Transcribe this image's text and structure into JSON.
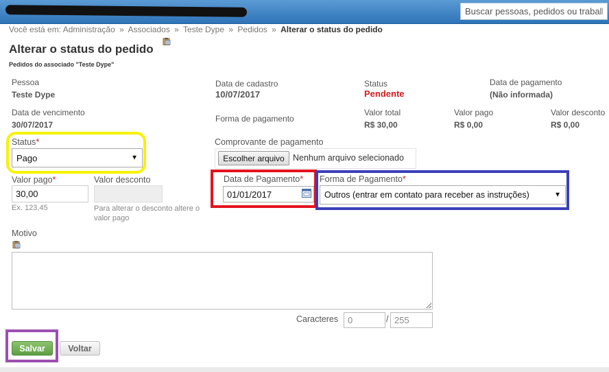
{
  "search": {
    "placeholder": "Buscar pessoas, pedidos ou trabalhos"
  },
  "breadcrumb": {
    "prefix": "Você está em:",
    "items": [
      "Administração",
      "Associados",
      "Teste Dype",
      "Pedidos"
    ],
    "current": "Alterar o status do pedido",
    "separator": "»"
  },
  "page": {
    "title": "Alterar o status do pedido",
    "subtitle": "Pedidos do associado \"Teste Dype\""
  },
  "info": {
    "pessoa_label": "Pessoa",
    "pessoa_value": "Teste Dype",
    "cadastro_label": "Data de cadastro",
    "cadastro_value": "10/07/2017",
    "status_label": "Status",
    "status_value": "Pendente",
    "pagamento_label": "Data de pagamento",
    "pagamento_value": "(Não informada)",
    "vencimento_label": "Data de vencimento",
    "vencimento_value": "30/07/2017",
    "forma_label": "Forma de pagamento",
    "valor_total_label": "Valor total",
    "valor_total_value": "R$ 30,00",
    "valor_pago_label": "Valor pago",
    "valor_pago_value": "R$ 0,00",
    "valor_desconto_label": "Valor desconto",
    "valor_desconto_value": "R$ 0,00"
  },
  "form": {
    "status_label": "Status",
    "status_value": "Pago",
    "comprovante_label": "Comprovante de pagamento",
    "file_button": "Escolher arquivo",
    "file_status": "Nenhum arquivo selecionado",
    "valor_pago_label": "Valor pago",
    "valor_pago_value": "30,00",
    "valor_pago_hint": "Ex. 123,45",
    "valor_desconto_label": "Valor desconto",
    "valor_desconto_hint": "Para alterar o desconto altere o valor pago",
    "data_pagamento_label": "Data de Pagamento",
    "data_pagamento_value": "01/01/2017",
    "forma_pagamento_label": "Forma de Pagamento",
    "forma_pagamento_value": "Outros (entrar em contato para receber as instruções)",
    "motivo_label": "Motivo",
    "caracteres_label": "Caracteres",
    "caracteres_count": "0",
    "caracteres_sep": "/",
    "caracteres_max": "255",
    "required_mark": "*"
  },
  "buttons": {
    "save": "Salvar",
    "back": "Voltar"
  },
  "colors": {
    "header": "#2f74b8",
    "required": "#d21e1e",
    "save_button": "#6aa84f",
    "highlight_yellow": "#f7f200",
    "highlight_red": "#e4141e",
    "highlight_blue": "#3a3fb8",
    "highlight_purple": "#9b4fb0"
  },
  "icons": {
    "clipboard": "clipboard-icon",
    "calendar": "calendar-icon",
    "dropdown": "chevron-down-icon"
  }
}
